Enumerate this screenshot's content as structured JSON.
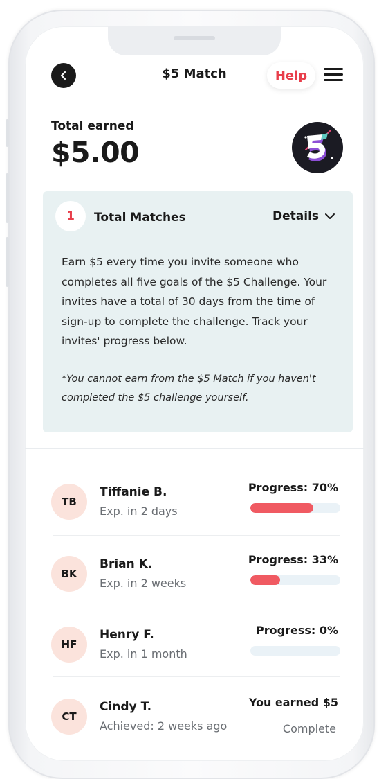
{
  "header": {
    "title": "$5 Match",
    "help_label": "Help"
  },
  "summary": {
    "earned_label": "Total earned",
    "earned_amount": "$5.00"
  },
  "matches_panel": {
    "count": "1",
    "title": "Total Matches",
    "details_label": "Details",
    "description": "Earn $5 every time you invite someone who completes all five goals of the $5 Challenge. Your invites have a total of 30 days from the time of sign-up to complete the challenge. Track your invites' progress below.",
    "note": "*You cannot earn from the $5 Match if you haven't completed the $5 challenge yourself."
  },
  "invites": [
    {
      "initials": "TB",
      "name": "Tiffanie B.",
      "expiry": "Exp. in 2 days",
      "progress_label": "Progress: 70%",
      "progress": 0.7
    },
    {
      "initials": "BK",
      "name": "Brian K.",
      "expiry": "Exp. in 2 weeks",
      "progress_label": "Progress: 33%",
      "progress": 0.33
    },
    {
      "initials": "HF",
      "name": "Henry F.",
      "expiry": "Exp. in 1 month",
      "progress_label": "Progress: 0%",
      "progress": 0.0
    },
    {
      "initials": "CT",
      "name": "Cindy T.",
      "expiry": "Achieved: 2 weeks ago",
      "progress_label": "You earned $5",
      "status": "Complete"
    }
  ],
  "colors": {
    "accent": "#e83e4b",
    "progress_fill": "#f05a62",
    "progress_track": "#eaf2f7",
    "panel_bg": "#e8f1f2",
    "avatar_bg": "#fbe3dc"
  },
  "icons": {
    "back": "chevron-left-icon",
    "menu": "hamburger-menu-icon",
    "details": "chevron-down-icon",
    "badge": "five-dollar-badge-icon"
  }
}
